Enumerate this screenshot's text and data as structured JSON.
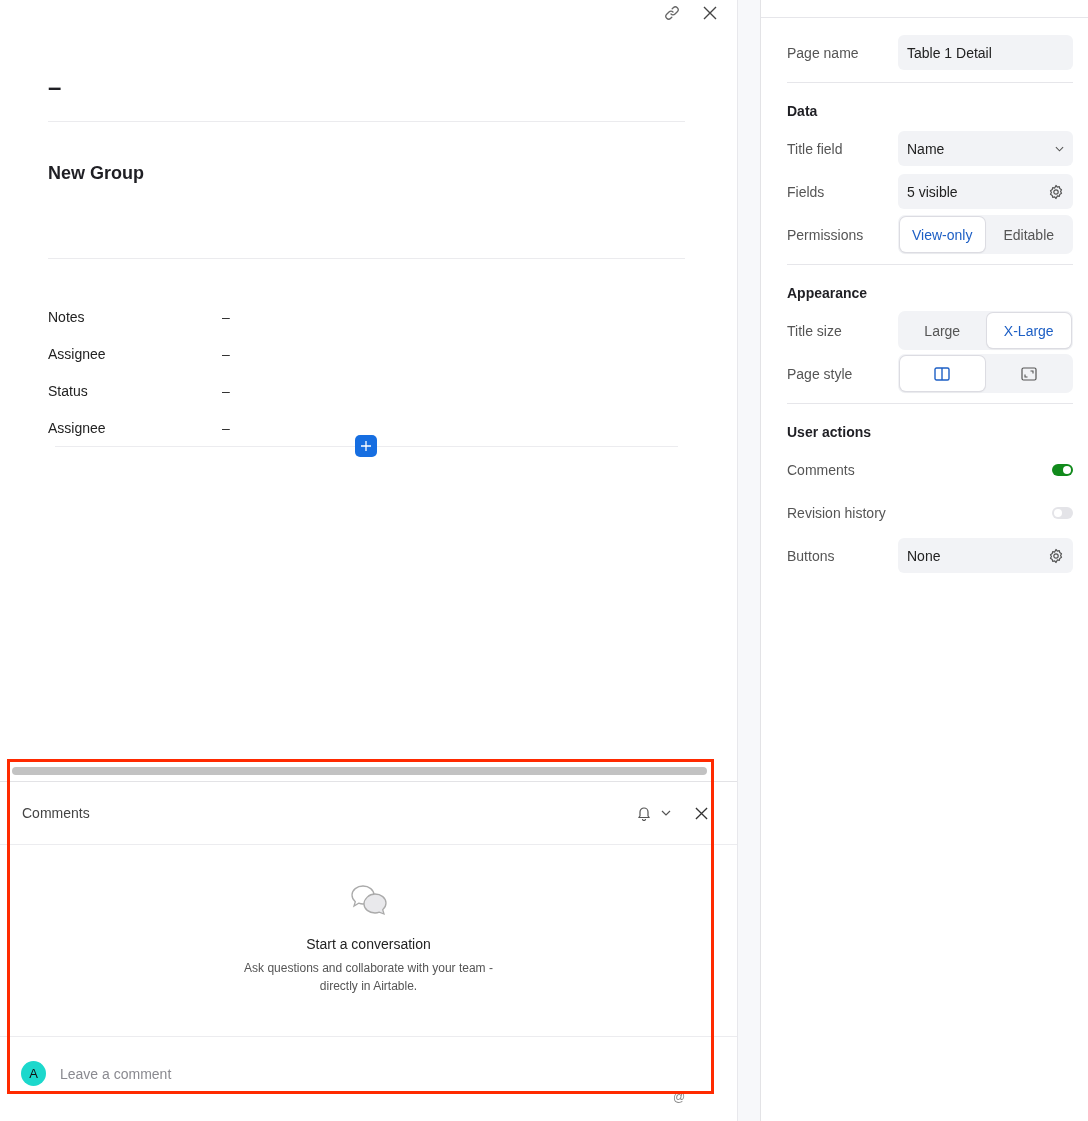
{
  "record": {
    "title": "–",
    "group_title": "New Group",
    "fields": [
      {
        "label": "Notes",
        "value": "–"
      },
      {
        "label": "Assignee",
        "value": "–"
      },
      {
        "label": "Status",
        "value": "–"
      },
      {
        "label": "Assignee",
        "value": "–"
      }
    ]
  },
  "comments": {
    "title": "Comments",
    "highlighted": true,
    "empty_title": "Start a conversation",
    "empty_text": "Ask questions and collaborate with your team - directly in Airtable.",
    "avatar": "A",
    "placeholder": "Leave a comment",
    "mention": "@"
  },
  "settings": {
    "page_name": {
      "label": "Page name",
      "value": "Table 1 Detail"
    },
    "sections": [
      {
        "title": "Data",
        "rows": [
          {
            "kind": "select",
            "label": "Title field",
            "value": "Name"
          },
          {
            "kind": "gear",
            "label": "Fields",
            "value": "5 visible"
          },
          {
            "kind": "segmented",
            "label": "Permissions",
            "options": [
              {
                "label": "View-only",
                "selected": true
              },
              {
                "label": "Editable",
                "selected": false
              }
            ]
          }
        ]
      },
      {
        "title": "Appearance",
        "rows": [
          {
            "kind": "segmented",
            "label": "Title size",
            "options": [
              {
                "label": "Large",
                "selected": false
              },
              {
                "label": "X-Large",
                "selected": true
              }
            ]
          },
          {
            "kind": "icon-segmented",
            "label": "Page style",
            "options": [
              {
                "kind": "side",
                "selected": true
              },
              {
                "kind": "full",
                "selected": false
              }
            ]
          }
        ]
      },
      {
        "title": "User actions",
        "rows": [
          {
            "kind": "toggle",
            "label": "Comments",
            "on": true
          },
          {
            "kind": "toggle",
            "label": "Revision history",
            "on": false
          },
          {
            "kind": "gear",
            "label": "Buttons",
            "value": "None"
          }
        ]
      }
    ]
  }
}
